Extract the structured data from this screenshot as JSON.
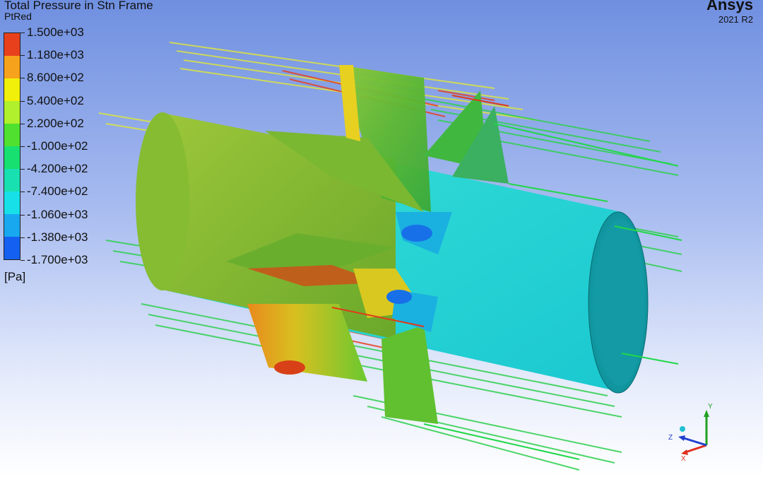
{
  "header": {
    "title": "Total Pressure in Stn Frame",
    "variable": "PtRed",
    "brand": "Ansys",
    "version": "2021 R2"
  },
  "legend": {
    "labels": [
      "1.500e+03",
      "1.180e+03",
      "8.600e+02",
      "5.400e+02",
      "2.200e+02",
      "-1.000e+02",
      "-4.200e+02",
      "-7.400e+02",
      "-1.060e+03",
      "-1.380e+03",
      "-1.700e+03"
    ],
    "colors": [
      "#e8401c",
      "#f7a21c",
      "#f0f00a",
      "#b0f02c",
      "#50e030",
      "#18e070",
      "#18e0b0",
      "#18e0e8",
      "#18a8f0",
      "#1460f0"
    ],
    "unit": "[Pa]"
  },
  "triad": {
    "x_label": "X",
    "y_label": "Y",
    "z_label": "Z",
    "x_color": "#e03020",
    "y_color": "#20a020",
    "z_color": "#2040d0"
  }
}
